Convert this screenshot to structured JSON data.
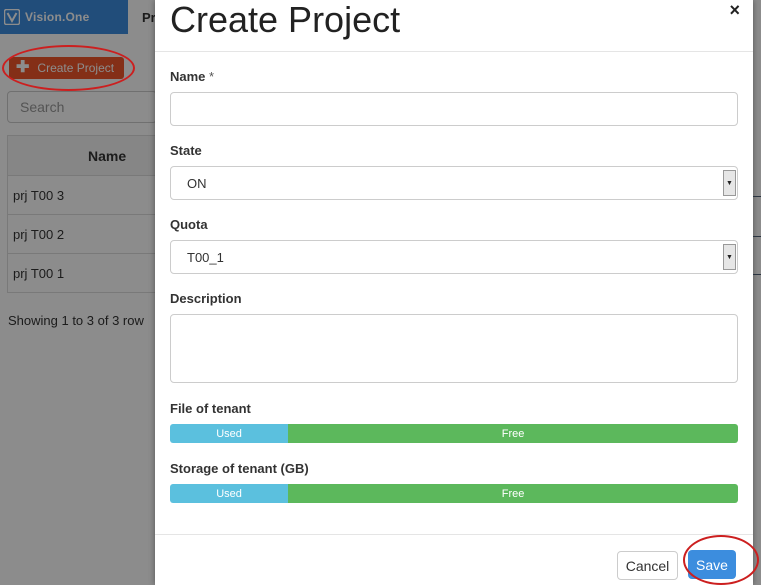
{
  "brand": {
    "name": "Vision.One"
  },
  "nav": {
    "peek_label": "Pr"
  },
  "create_project_button": {
    "label": "Create Project"
  },
  "search": {
    "placeholder": "Search"
  },
  "table": {
    "header": "Name",
    "rows": [
      "prj T00 3",
      "prj T00 2",
      "prj T00 1"
    ]
  },
  "pagination": {
    "summary": "Showing 1 to 3 of 3 row"
  },
  "modal": {
    "title": "Create Project",
    "close_glyph": "×",
    "name_label": "Name",
    "name_required": " *",
    "name_value": "",
    "state_label": "State",
    "state_value": "ON",
    "quota_label": "Quota",
    "quota_value": "T00_1",
    "description_label": "Description",
    "description_value": "",
    "file_label": "File of tenant",
    "file_used_label": "Used",
    "file_free_label": "Free",
    "file_used_fraction": 0.208,
    "storage_label": "Storage of tenant (GB)",
    "storage_used_label": "Used",
    "storage_free_label": "Free",
    "storage_used_fraction": 0.208,
    "cancel_label": "Cancel",
    "save_label": "Save"
  },
  "colors": {
    "brand": "#3c8dde",
    "create_button": "#f0572a",
    "annotation": "#cc1f1f",
    "bar_used": "#5bc0de",
    "bar_free": "#5cb85c",
    "save_button": "#3c8dde"
  }
}
